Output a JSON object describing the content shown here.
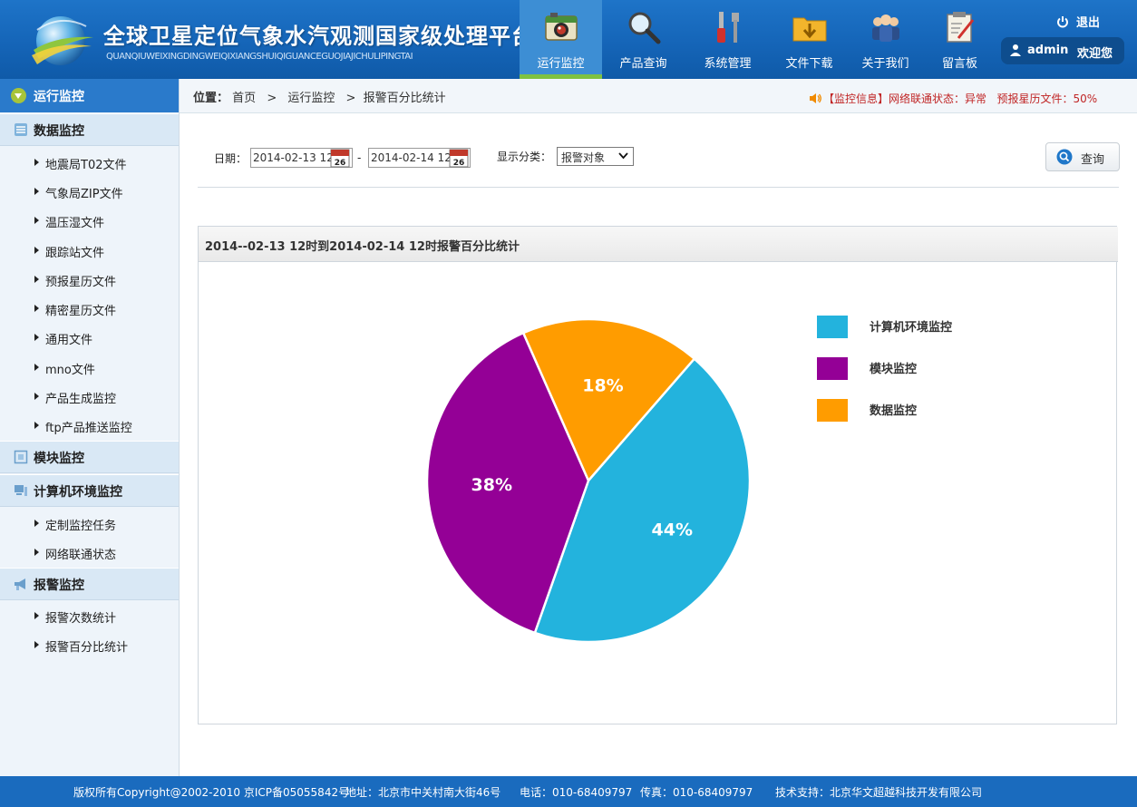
{
  "header": {
    "title": "全球卫星定位气象水汽观测国家级处理平台",
    "subtitle": "QUANQIUWEIXINGDINGWEIQIXIANGSHUIQIGUANCEGUOJIAJICHULIPINGTAI",
    "nav": [
      {
        "label": "运行监控",
        "icon": "camera-monitor-icon",
        "active": true
      },
      {
        "label": "产品查询",
        "icon": "magnifier-icon"
      },
      {
        "label": "系统管理",
        "icon": "tools-icon"
      },
      {
        "label": "文件下载",
        "icon": "folder-download-icon"
      },
      {
        "label": "关于我们",
        "icon": "users-icon"
      },
      {
        "label": "留言板",
        "icon": "notepad-icon"
      }
    ],
    "logout_label": "退出",
    "user": {
      "name": "admin",
      "welcome": "欢迎您"
    }
  },
  "sidebar": {
    "top": "运行监控",
    "groups": [
      {
        "label": "数据监控",
        "icon": "server-icon",
        "items": [
          "地震局T02文件",
          "气象局ZIP文件",
          "温压湿文件",
          "跟踪站文件",
          "预报星历文件",
          "精密星历文件",
          "通用文件",
          "mno文件",
          "产品生成监控",
          "ftp产品推送监控"
        ]
      },
      {
        "label": "模块监控",
        "icon": "module-icon",
        "items": []
      },
      {
        "label": "计算机环境监控",
        "icon": "computer-icon",
        "items": [
          "定制监控任务",
          "网络联通状态"
        ]
      },
      {
        "label": "报警监控",
        "icon": "megaphone-icon",
        "items": [
          "报警次数统计",
          "报警百分比统计"
        ]
      }
    ]
  },
  "breadcrumb": {
    "prefix": "位置：",
    "items": [
      "首页",
      "运行监控",
      "报警百分比统计"
    ],
    "separator": ">"
  },
  "status": {
    "text": "【监控信息】网络联通状态：异常   预报星历文件：50%"
  },
  "filter": {
    "date_label": "日期：",
    "start_date": "2014-02-13 12",
    "end_date": "2014-02-14 12",
    "range_sep": "-",
    "calendar_day": "26",
    "category_label": "显示分类：",
    "category_value": "报警对象",
    "query_label": "查询"
  },
  "chart_title": "2014--02-13 12时到2014-02-14 12时报警百分比统计",
  "chart_data": {
    "type": "pie",
    "title": "",
    "series": [
      {
        "name": "计算机环境监控",
        "value": 44,
        "label": "44%",
        "color": "#23b3dd"
      },
      {
        "name": "模块监控",
        "value": 38,
        "label": "38%",
        "color": "#940096"
      },
      {
        "name": "数据监控",
        "value": 18,
        "label": "18%",
        "color": "#ff9c00"
      }
    ],
    "legend_position": "right"
  },
  "footer": {
    "copyright": "版权所有Copyright@2002-2010 京ICP备05055842号",
    "address": "地址：北京市中关村南大街46号",
    "phone": "电话：010-68409797",
    "fax": "传真：010-68409797",
    "support": "技术支持：北京华文超越科技开发有限公司"
  }
}
